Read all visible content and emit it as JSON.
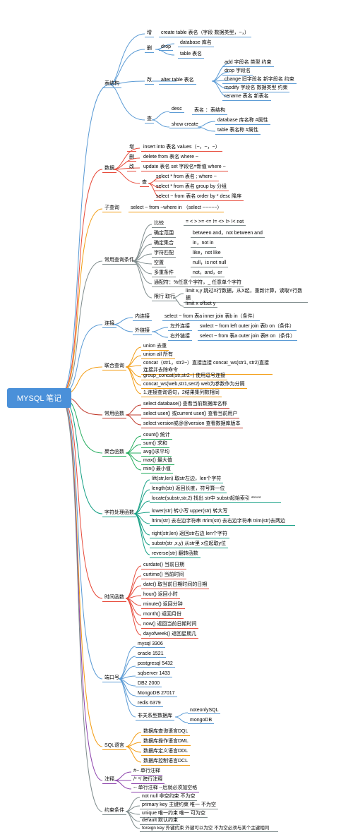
{
  "root": "MYSQL          笔记",
  "l1": {
    "struct": "表结构",
    "data": "数据",
    "subq": "子查询",
    "cond": "常用查询条件",
    "join": "连接",
    "union": "联合查询",
    "func": "常用函数",
    "agg": "聚合函数",
    "str": "字符处理函数",
    "time": "时间函数",
    "port": "端口号",
    "sql": "SQL语言",
    "comment": "注释",
    "constraint": "约束条件"
  },
  "struct": {
    "add": "增",
    "add_v": "create table 表名（字段 数据类型，~，）",
    "del": "删",
    "del_c": "drop",
    "del_db": "database 库名",
    "del_tb": "table 表名",
    "mod": "改",
    "mod_c": "alter table 表名",
    "mod_1": "add 字段名 类型 约束",
    "mod_2": "drop 字段名",
    "mod_3": "change 旧字段名 新字段名 约束",
    "mod_4": "modify 字段名 数据类型 约束",
    "mod_5": "rename 表名 新表名",
    "q": "查",
    "q_desc": "desc",
    "q_desc_v": "表名  ：表结构",
    "q_show": "show create",
    "q_show_1": "database 库名称 #属性",
    "q_show_2": "table 表名称  #属性"
  },
  "data": {
    "add": "增",
    "add_v": "insert into 表名 values（~，~，~）",
    "del": "删",
    "del_v": "delete from 表名 where ~",
    "mod": "改",
    "mod_v": "update 表名 set 字段名=新值 where ~",
    "q": "查",
    "q_1": "select * from 表名 ; where ~",
    "q_2": "select * from 表名 group by  分组",
    "q_3": "select ~ from 表名 order by *  desc 降序"
  },
  "subq_v": "select ~ from ~where in （select ~~~~~）",
  "cond": {
    "cmp": "比较",
    "cmp_v": "= < > >= <= != <> !> !< not",
    "range": "确定范围",
    "range_v": "between and，not between and",
    "set": "确定集合",
    "set_v": "in，not in",
    "like": "字符匹配",
    "like_v": "like，not like",
    "null": "空置",
    "null_v": "null，is not null",
    "multi": "多重条件",
    "multi_v": "not，and，or",
    "match": "通配符：%任意个字符，_ 任意单个字符",
    "limit": "限行 取行",
    "limit_1": "limit x,y 跳过X行数据，从X起，重新计算，读取Y行数据",
    "limit_2": "limit x offset y"
  },
  "join": {
    "inner": "内连接",
    "inner_v": "select ~ from 表a inner join 表b in（条件）",
    "outer": "外链接",
    "left": "左外连接",
    "left_v": "swlect ~ from left outer join 表b on（条件）",
    "right": "右外链接",
    "right_v": "select ~ from 表a outer join 表B on（条件）"
  },
  "union": {
    "u1": "union 去重",
    "u2": "union all 所有",
    "u3": "concat（str1，str2~）直接连接 concat_ws(str1, str2)直接连接并去除命令",
    "u4": "group_concat(str,str2~)  使用逗号连接",
    "u5": "concat_ws(web,str1,ser2)   web为参数作为分隔",
    "u6": "1.连接查询语句，2结果集列数相同"
  },
  "func": {
    "f1": "select database() 查看当前数据库名称",
    "f2": "select user() 或current user()           查看当前用户",
    "f3": "select version或@@version              查看数据库版本"
  },
  "agg": {
    "a1": "count() 统计",
    "a2": "sum() 求和",
    "a3": "avg()求平均",
    "a4": "max() 最大值",
    "a5": "min() 最小值"
  },
  "str": {
    "s1": "lift(str,len) 取str左边，len个字符",
    "s2": "length(str) 返回长度，符号算一位",
    "s3": "locate(substr,str,2) 找出 str中 substr起始索引 *****",
    "s4": "lower(str) 转小写 upper(str)  转大写",
    "s5": "ltrim(str) 去左边字符串 rtrim(str) 去右边字符串 trim(str)去两边",
    "s6": "right(str,len) 返回str右边 len个字符",
    "s7": "substr(str ,x,y) 从str里 x位起取y位",
    "s8": "reverse(str) 翻转函数"
  },
  "time": {
    "t1": "curdate() 当前日期",
    "t2": "curtime() 当前时间",
    "t3": "date() 取当前日期时间的日期",
    "t4": "hour() 返回小时",
    "t5": "minute() 返回分钟",
    "t6": "month() 返回月份",
    "t7": "now() 返回当前日期时间",
    "t8": "dayofweek() 返回星期几"
  },
  "port": {
    "p1": "mysql 3306",
    "p2": "oracle 1521",
    "p3": "postgresql 5432",
    "p4": "sqlserver 1433",
    "p5": "DB2 2000",
    "p6": "MongoDB 27017",
    "p7": "redis 6379",
    "p8": "非关系型数据库",
    "p8_1": "noteonlySQL",
    "p8_2": "mongoDB"
  },
  "sql": {
    "l1": "数据库查询语言DQL",
    "l2": "数据库操作语言DML",
    "l3": "数据库定义语言DDL",
    "l4": "数据库控制语言DCL"
  },
  "comment": {
    "c1": "#~  单行注释",
    "c2": "/* */ 跨行注释",
    "c3": "-- 单行注释 --后就必须加空格"
  },
  "constraint": {
    "k1": "not null 非空约束   不为空",
    "k2": "primary key 主键约束  唯一  不为空",
    "k3": "unique 唯一约束  唯一 可为空",
    "k4": "default 默认约束",
    "k5": "foreign key 外键约束 外键可以为空 不为空必须与某个主键相同"
  }
}
